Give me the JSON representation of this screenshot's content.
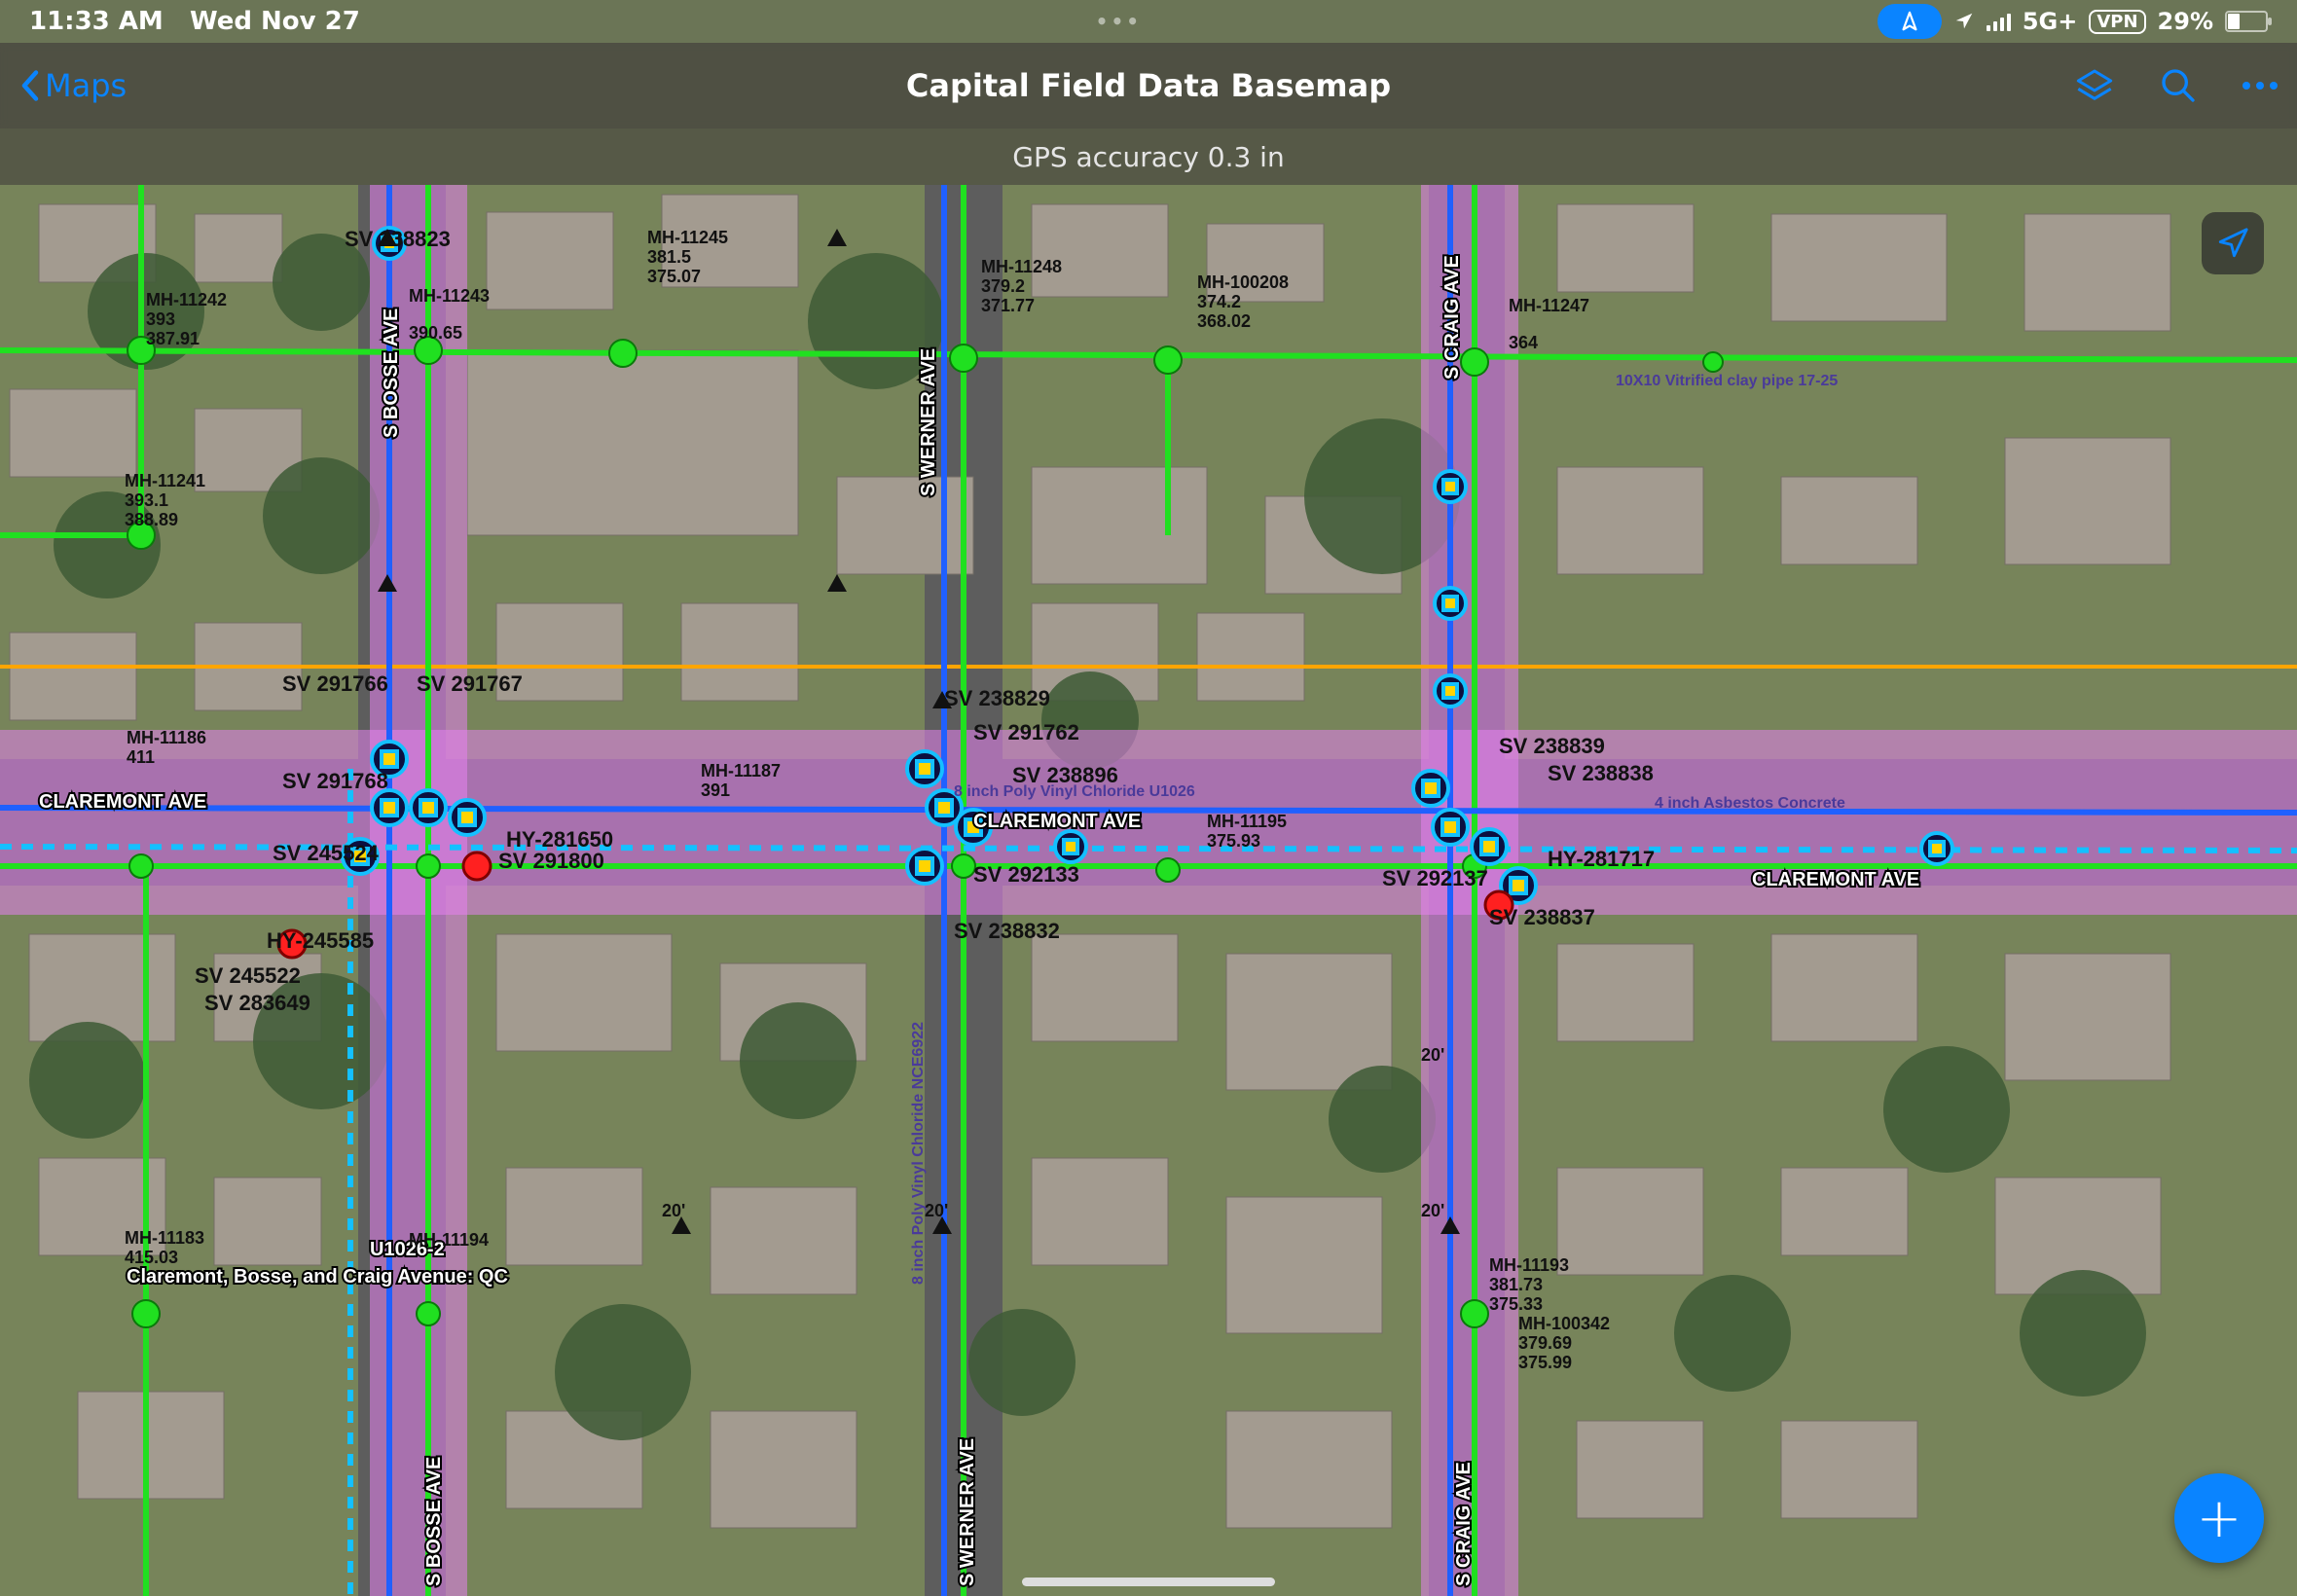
{
  "status": {
    "time": "11:33 AM",
    "date": "Wed Nov 27",
    "network": "5G+",
    "vpn": "VPN",
    "battery_pct": "29%"
  },
  "nav": {
    "back_label": "Maps",
    "page_title": "Capital Field Data Basemap"
  },
  "substatus": "GPS accuracy 0.3 in",
  "project_label": "Claremont, Bosse, and Craig Avenue: QC",
  "project_id": "U1026-2",
  "streets": {
    "claremont": "CLAREMONT AVE",
    "bosse": "S BOSSE AVE",
    "werner": "S WERNER AVE",
    "craig": "S CRAIG AVE"
  },
  "water_notes": {
    "a": "4 inch Asbestos Concrete",
    "b": "8 inch Poly Vinyl Chloride U1026",
    "c": "8 inch Poly Vinyl Chloride NCE6922",
    "d": "10X10 Vitrified clay pipe 17-25"
  },
  "manholes": [
    {
      "id": "MH-11242",
      "e": "393",
      "l": "387.91"
    },
    {
      "id": "MH-11241",
      "e": "393.1",
      "l": "388.89"
    },
    {
      "id": "MH-11243",
      "e": "",
      "l": "390.65"
    },
    {
      "id": "MH-11245",
      "e": "381.5",
      "l": "375.07"
    },
    {
      "id": "MH-11248",
      "e": "379.2",
      "l": "371.77"
    },
    {
      "id": "MH-100208",
      "e": "374.2",
      "l": "368.02"
    },
    {
      "id": "MH-11247",
      "e": "",
      "l": "364"
    },
    {
      "id": "MH-11186",
      "e": "411",
      "l": ""
    },
    {
      "id": "MH-11183",
      "e": "415.03",
      "l": ""
    },
    {
      "id": "MH-11194",
      "e": "",
      "l": ""
    },
    {
      "id": "MH-11187",
      "e": "391",
      "l": ""
    },
    {
      "id": "MH-11193",
      "e": "381.73",
      "l": "375.33"
    },
    {
      "id": "MH-100342",
      "e": "379.69",
      "l": "375.99"
    },
    {
      "id": "MH-11195",
      "e": "",
      "l": "375.93"
    }
  ],
  "valves": [
    {
      "id": "SV  238823"
    },
    {
      "id": "SV  291766"
    },
    {
      "id": "SV  291767"
    },
    {
      "id": "SV  291768"
    },
    {
      "id": "SV  245524"
    },
    {
      "id": "SV  291800"
    },
    {
      "id": "SV  245522"
    },
    {
      "id": "SV  283649"
    },
    {
      "id": "SV  238829"
    },
    {
      "id": "SV  291762"
    },
    {
      "id": "SV  238832"
    },
    {
      "id": "SV  292133"
    },
    {
      "id": "SV  292137"
    },
    {
      "id": "SV  238839"
    },
    {
      "id": "SV  238838"
    },
    {
      "id": "SV  238837"
    },
    {
      "id": "SV  238896"
    }
  ],
  "hydrants": [
    {
      "id": "HY-281650"
    },
    {
      "id": "HY-245585"
    },
    {
      "id": "HY-281717"
    }
  ],
  "depths": [
    {
      "v": "20'"
    },
    {
      "v": "20'"
    },
    {
      "v": "20'"
    },
    {
      "v": "20'"
    }
  ]
}
